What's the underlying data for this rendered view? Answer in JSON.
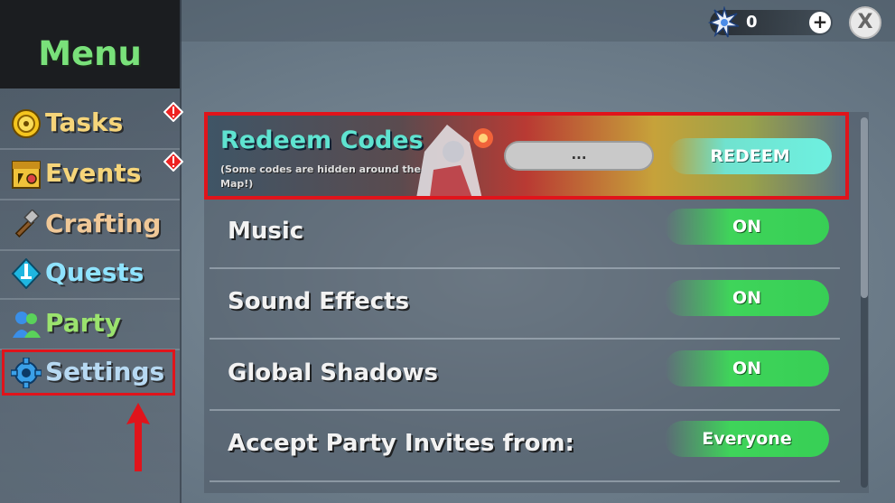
{
  "sidebar": {
    "title": "Menu",
    "items": [
      {
        "label": "Tasks",
        "color": "#f6d57a",
        "icon": "tasks-coin-icon",
        "alert": true
      },
      {
        "label": "Events",
        "color": "#f6d57a",
        "icon": "events-calendar-icon",
        "alert": true
      },
      {
        "label": "Crafting",
        "color": "#f0c897",
        "icon": "hammer-icon",
        "alert": false
      },
      {
        "label": "Quests",
        "color": "#8fe3ff",
        "icon": "quest-sword-icon",
        "alert": false
      },
      {
        "label": "Party",
        "color": "#9be36e",
        "icon": "party-people-icon",
        "alert": false
      },
      {
        "label": "Settings",
        "color": "#b7d9f2",
        "icon": "gear-icon",
        "alert": false
      }
    ]
  },
  "currency": {
    "amount": "0",
    "plus": "+",
    "icon": "crystal-currency-icon"
  },
  "close_button": {
    "label": "X"
  },
  "redeem": {
    "title": "Redeem Codes",
    "subtitle": "(Some codes are hidden around the Map!)",
    "input_value": "...",
    "button_label": "REDEEM"
  },
  "settings": [
    {
      "label": "Music",
      "value": "ON"
    },
    {
      "label": "Sound Effects",
      "value": "ON"
    },
    {
      "label": "Global Shadows",
      "value": "ON"
    },
    {
      "label": "Accept Party Invites from:",
      "value": "Everyone"
    }
  ],
  "colors": {
    "menu_title": "#79e17a",
    "highlight_red": "#e0141b",
    "toggle_green": "#37cf55",
    "redeem_cyan": "#6ef0e0"
  }
}
